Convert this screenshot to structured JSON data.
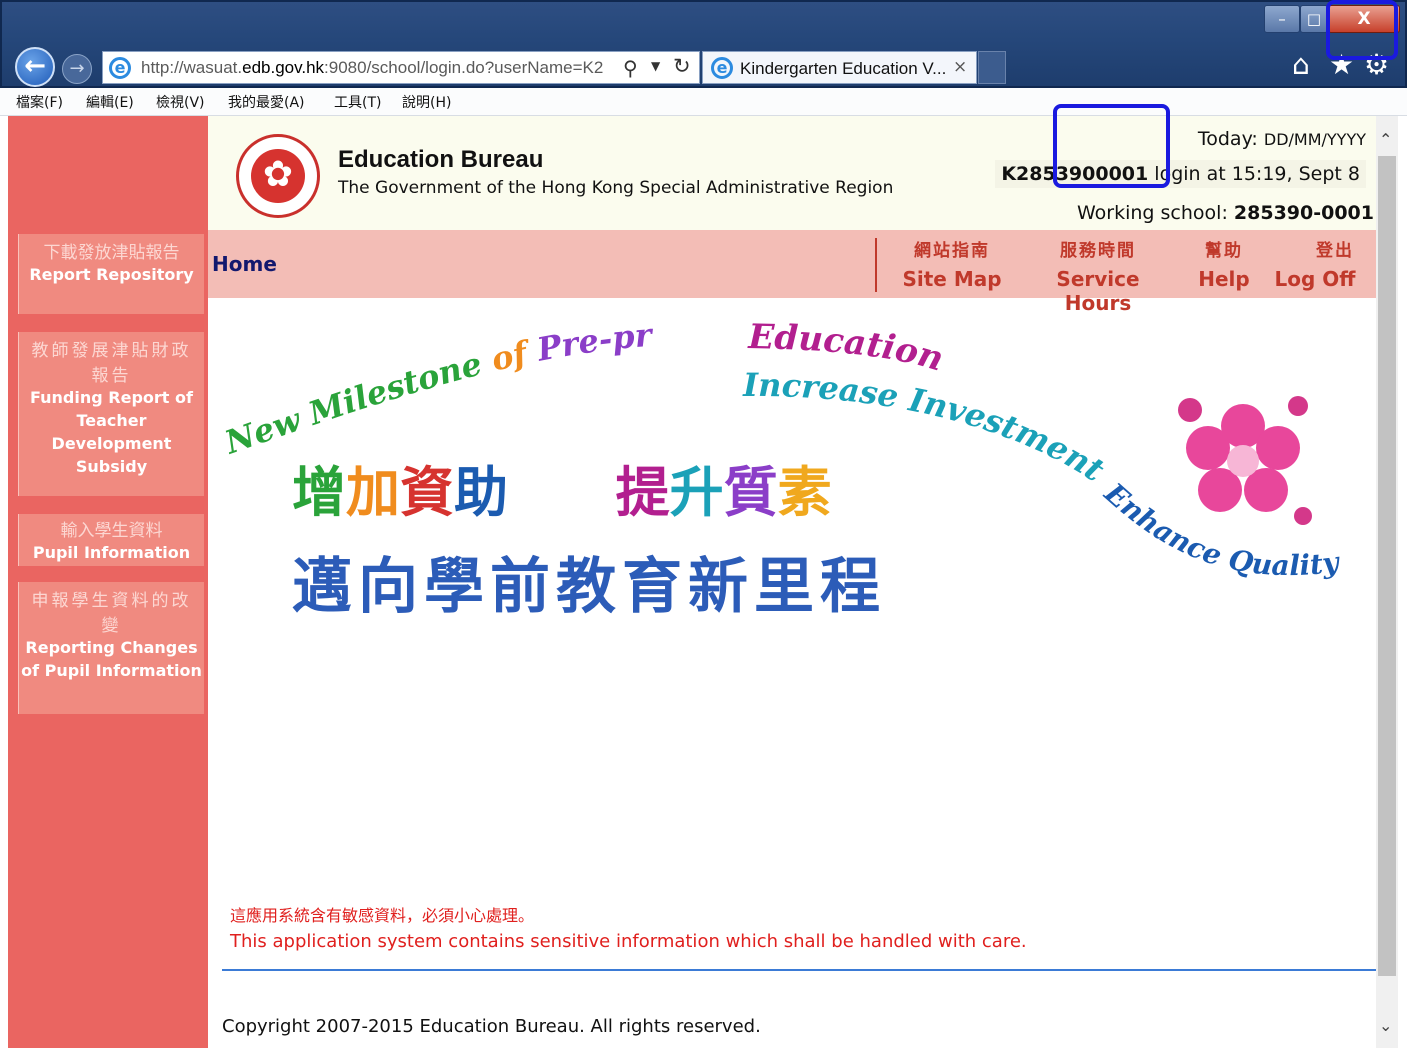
{
  "browser": {
    "address_url_prefix": "http://wasuat.",
    "address_url_domain": "edb.gov.hk",
    "address_url_rest": ":9080/school/login.do?userName=K2",
    "tab_title": "Kindergarten Education V...",
    "tab_close": "×",
    "win_min": "–",
    "win_max": "□",
    "win_close": "X"
  },
  "menubar": [
    "檔案(F)",
    "編輯(E)",
    "檢視(V)",
    "我的最愛(A)",
    "工具(T)",
    "說明(H)"
  ],
  "sidebar": {
    "items": [
      {
        "zh": "下載發放津貼報告",
        "en": "Report Repository"
      },
      {
        "zh": "教師發展津貼財政報告",
        "en": "Funding Report of Teacher Development Subsidy"
      },
      {
        "zh": "輸入學生資料",
        "en": "Pupil Information"
      },
      {
        "zh": "申報學生資料的改變",
        "en": "Reporting Changes of Pupil Information"
      }
    ]
  },
  "header": {
    "org_name": "Education Bureau",
    "org_sub": "The Government of the Hong Kong Special Administrative Region",
    "today_label": "Today:",
    "today_value": "DD/MM/YYYY",
    "login_user": "K2853900001",
    "login_text": "login at 15:19,",
    "login_date": "Sept 8",
    "working_school_label": "Working school:",
    "working_school_value": "285390-0001"
  },
  "nav": {
    "home": "Home",
    "links": [
      {
        "zh": "網站指南",
        "en": "Site Map"
      },
      {
        "zh": "服務時間",
        "en": "Service Hours"
      },
      {
        "zh": "幫助",
        "en": "Help"
      },
      {
        "zh": "登出",
        "en": "Log Off"
      }
    ]
  },
  "banner": {
    "arc_line1": "New Milestone",
    "arc_of": "of",
    "arc_line2": "Pre-primary",
    "arc_line3": "Education",
    "arc_line4": "Increase Investment",
    "arc_line5": "Enhance Quality",
    "zh_line1_a": [
      "增",
      "加",
      "資",
      "助"
    ],
    "zh_line1_b": [
      "提",
      "升",
      "質",
      "素"
    ],
    "zh_line2": "邁向學前教育新里程"
  },
  "notice": {
    "zh": "這應用系統含有敏感資料，必須小心處理。",
    "en": "This application system contains sensitive information which shall be handled with care."
  },
  "footer": {
    "copyright": "Copyright 2007-2015 Education Bureau. All rights reserved."
  }
}
